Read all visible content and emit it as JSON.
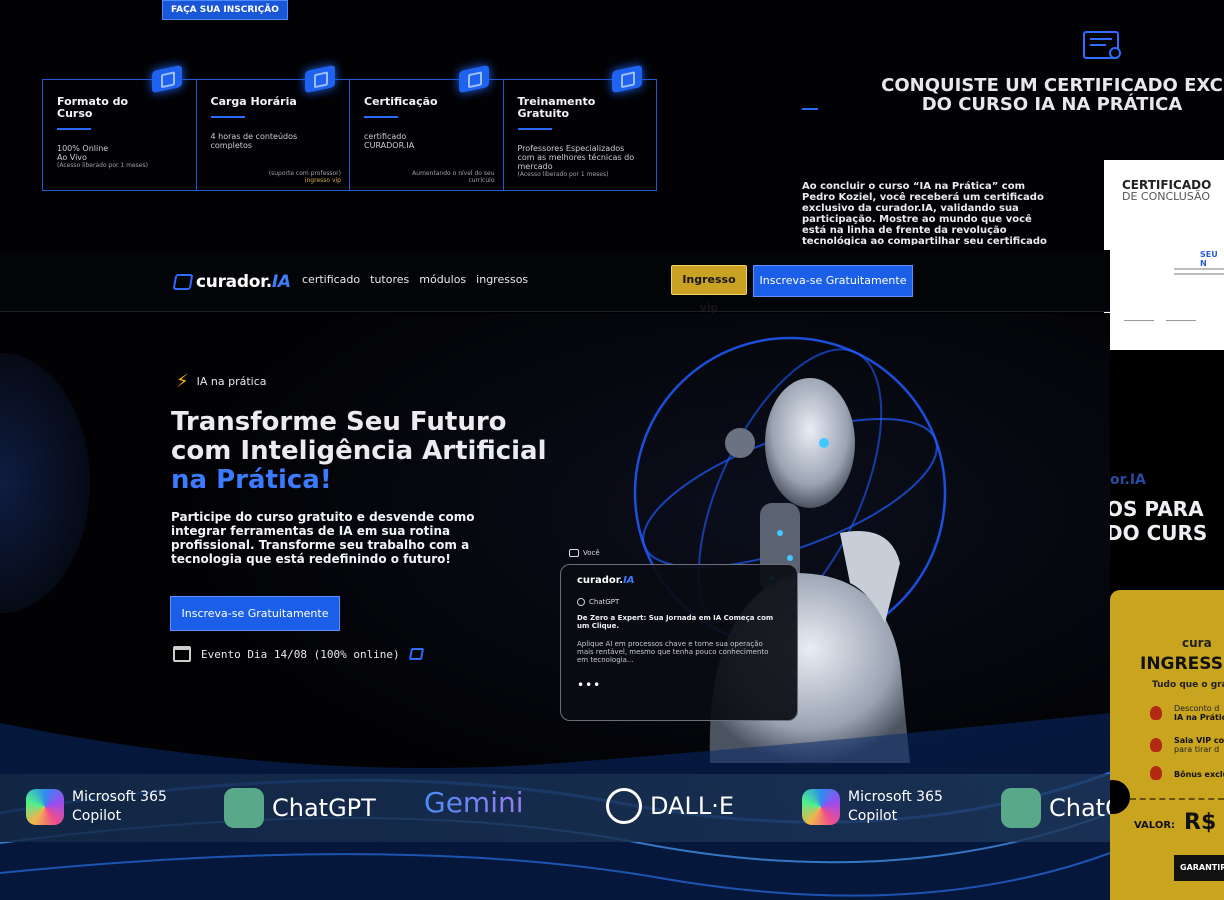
{
  "top": {
    "cta_label": "FAÇA SUA INSCRIÇÃO",
    "cards": [
      {
        "title": "Formato do Curso",
        "text": "100% Online\nAo Vivo",
        "small": "(Acesso liberado por 1 meses)",
        "note": ""
      },
      {
        "title": "Carga Horária",
        "text": "4 horas de conteúdos completos",
        "small": "",
        "note": "(suporte com professor)",
        "note_accent": "ingresso vip"
      },
      {
        "title": "Certificação",
        "text": "certificado CURADOR.IA",
        "small": "",
        "note": "Aumentando o nível do seu currículo"
      },
      {
        "title": "Treinamento Gratuito",
        "text": "Professores Especializados com as melhores técnicas do mercado",
        "small": "(Acesso liberado por 1 meses)",
        "note": ""
      }
    ],
    "certificate": {
      "title_line1": "CONQUISTE UM CERTIFICADO EXC",
      "title_line2": "DO CURSO IA NA PRÁTICA",
      "description": "Ao concluir o curso “IA na Prática” com Pedro Koziel, você receberá um certificado exclusivo da curador.IA, validando sua participação. Mostre ao mundo que você está na linha de frente da revolução tecnológica ao compartilhar seu certificado no LinkedIn e outras redes sociais.",
      "preview_line1": "CERTIFICADO",
      "preview_line2": "DE CONCLUSÃO",
      "preview_name": "SEU N"
    }
  },
  "nav": {
    "logo_main": "curador.",
    "logo_accent": "IA",
    "links": [
      "certificado",
      "tutores",
      "módulos",
      "ingressos"
    ],
    "vip_label": "Ingresso vip",
    "cta_label": "Inscreva-se Gratuitamente"
  },
  "hero": {
    "tag": "IA na prática",
    "title_line1": "Transforme Seu Futuro",
    "title_line2": "com Inteligência Artificial",
    "title_accent": "na Prática!",
    "subtitle": "Participe do curso gratuito e desvende como integrar ferramentas de IA em sua rotina profissional. Transforme seu trabalho com a tecnologia que está redefinindo o futuro!",
    "cta_label": "Inscreva-se Gratuitamente",
    "event_text": "Evento Dia 14/08 (100% online)",
    "chat": {
      "you_label": "Você",
      "logo_main": "curador.",
      "logo_accent": "IA",
      "model": "ChatGPT",
      "headline": "De Zero a Expert: Sua Jornada em IA Começa com um Clique.",
      "body": "Aplique AI em processos chave e torne sua operação mais rentável, mesmo que tenha pouco conhecimento em tecnologia...",
      "dots": "•••"
    }
  },
  "brands": [
    {
      "name": "Microsoft 365",
      "sub": "Copilot"
    },
    {
      "name": "ChatGPT"
    },
    {
      "name": "Gemini"
    },
    {
      "name": "DALL·E"
    },
    {
      "name": "Microsoft 365",
      "sub": "Copilot"
    },
    {
      "name": "ChatG"
    }
  ],
  "right_panel": {
    "logo": "or.IA",
    "title_line1": "OS PARA",
    "title_line2": "DO CURS",
    "ticket": {
      "logo": "cura",
      "heading": "INGRESS",
      "sub": "Tudo que o gra",
      "rows": [
        {
          "line1": "Desconto d",
          "line2": "IA na Prátic"
        },
        {
          "line1": "Sala VIP co",
          "line2": "para tirar d"
        },
        {
          "line1": "Bônus exclu",
          "line2": ""
        }
      ],
      "valor_label": "VALOR:",
      "price": "R$",
      "button": "GARANTIR"
    }
  },
  "colors": {
    "accent_blue": "#1b5fe8",
    "gold": "#c9a224",
    "background": "#020204"
  }
}
